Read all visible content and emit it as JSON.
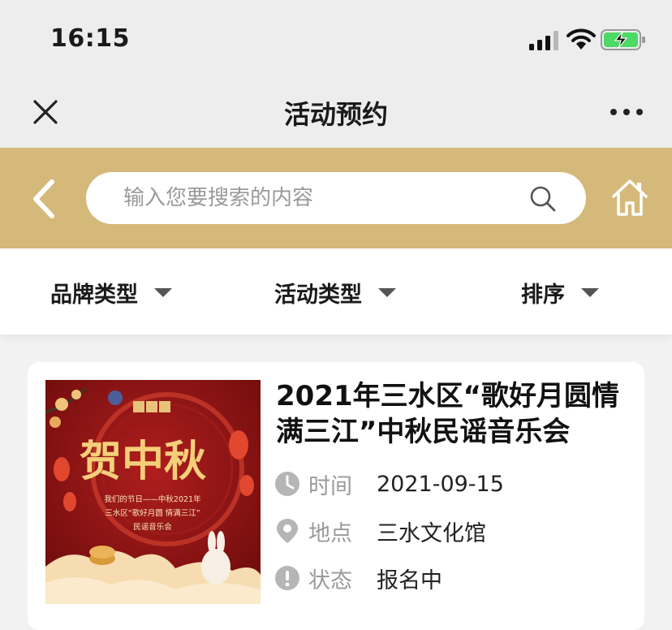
{
  "status_bar": {
    "time": "16:15"
  },
  "nav": {
    "title": "活动预约"
  },
  "search": {
    "placeholder": "输入您要搜索的内容"
  },
  "filters": [
    {
      "label": "品牌类型"
    },
    {
      "label": "活动类型"
    },
    {
      "label": "排序"
    }
  ],
  "activities": [
    {
      "title": "2021年三水区“歌好月圆情满三江”中秋民谣音乐会",
      "time_label": "时间",
      "time_value": "2021-09-15",
      "place_label": "地点",
      "place_value": "三水文化馆",
      "status_label": "状态",
      "status_value": "报名中",
      "poster": {
        "headline": "贺中秋",
        "line1": "我们的节日——中秋2021年",
        "line2": "三水区“歌好月圆 情满三江”",
        "line3": "民谣音乐会"
      }
    }
  ],
  "colors": {
    "accent_gold": "#d4b97a",
    "nav_bg": "#ededed",
    "page_bg": "#f2f2f2",
    "battery_green": "#4cd964",
    "poster_red": "#8f1313"
  },
  "icons": [
    "signal-icon",
    "wifi-icon",
    "battery-icon",
    "close-icon",
    "more-icon",
    "back-arrow-icon",
    "search-icon",
    "home-icon",
    "caret-down-icon",
    "clock-icon",
    "location-pin-icon",
    "alert-icon"
  ]
}
